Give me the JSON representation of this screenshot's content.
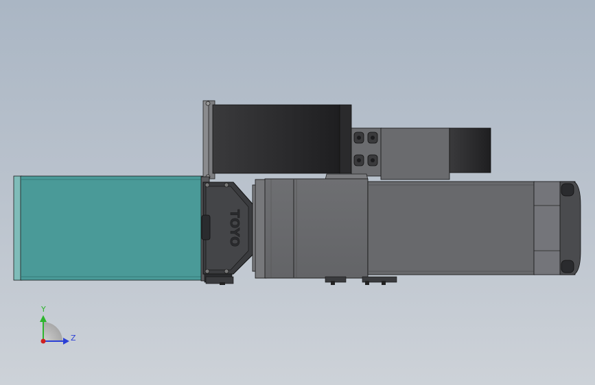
{
  "model": {
    "logo_text": "TOYO",
    "motor_color": "#4a9a98",
    "body_color": "#6a6b6e",
    "belt_color": "#2e2e30"
  },
  "triad": {
    "y_label": "Y",
    "z_label": "Z",
    "y_color": "#2db52d",
    "z_color": "#2a3fd6",
    "origin_color": "#d02020"
  }
}
